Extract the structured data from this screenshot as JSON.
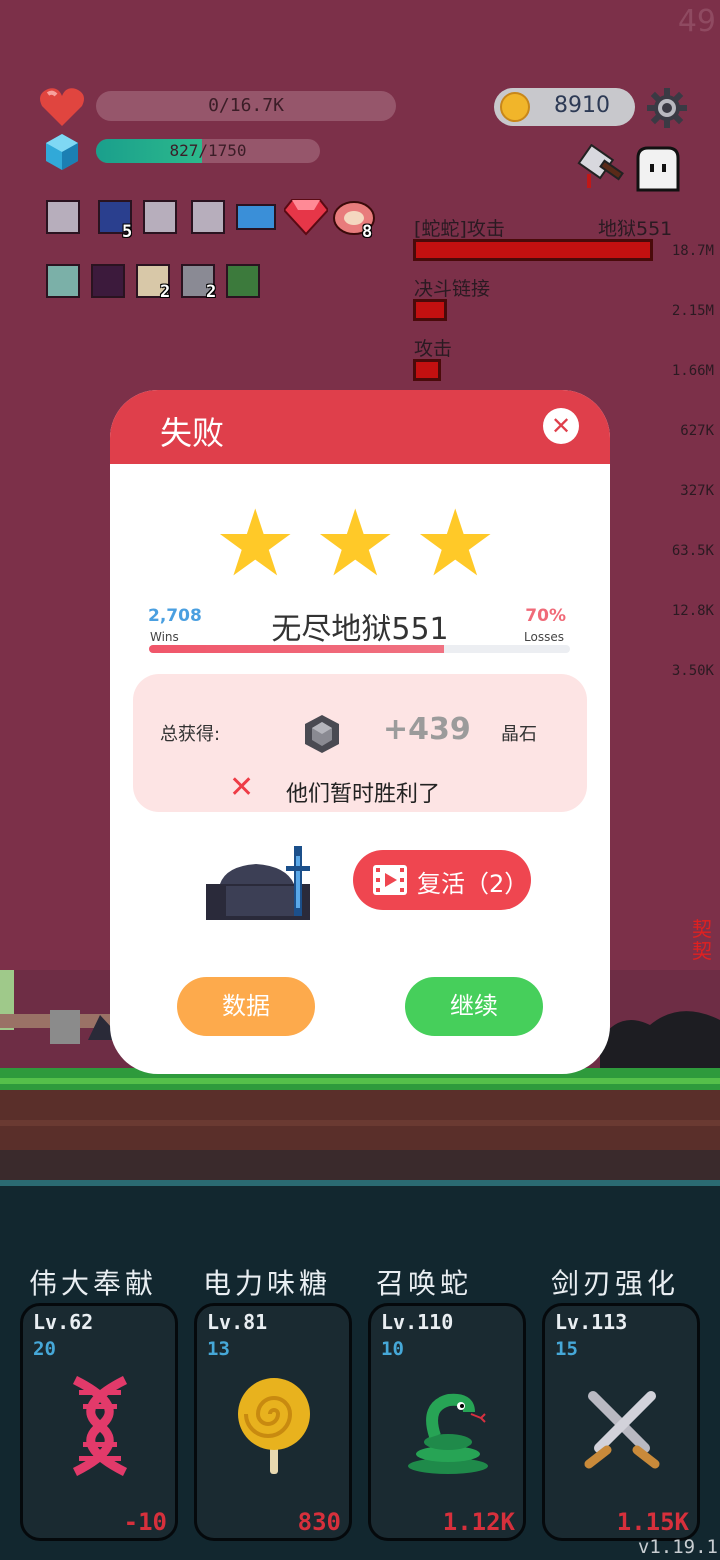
{
  "corner_number": "49",
  "hp": {
    "text": "0/16.7K",
    "fraction": 0.0
  },
  "xp": {
    "text_current": "827",
    "text_max": "/1750",
    "fraction": 0.473
  },
  "coins": {
    "value": "8910"
  },
  "inventory": {
    "row1": [
      {
        "icon": "scroll-ribbon-icon",
        "count": ""
      },
      {
        "icon": "holy-book-icon",
        "count": "5"
      },
      {
        "icon": "scroll-ribbon-icon",
        "count": ""
      },
      {
        "icon": "scroll-ribbon-icon",
        "count": ""
      },
      {
        "icon": "star-card-icon",
        "count": ""
      },
      {
        "icon": "ruby-gem-icon",
        "count": ""
      },
      {
        "icon": "meat-icon",
        "count": "8"
      }
    ],
    "row2": [
      {
        "icon": "lightbulb-tile-icon",
        "count": ""
      },
      {
        "icon": "demon-tile-icon",
        "count": ""
      },
      {
        "icon": "shell-tile-icon",
        "count": "2"
      },
      {
        "icon": "sword-tile-icon",
        "count": "2"
      },
      {
        "icon": "clover-tile-icon",
        "count": ""
      }
    ]
  },
  "combat_log": {
    "attacker": "[蛇蛇]攻击",
    "target": "地狱551",
    "rows": [
      {
        "label": "决斗链接"
      },
      {
        "label": "攻击"
      }
    ],
    "damage_values": [
      "18.7M",
      "2.15M",
      "1.66M",
      "627K",
      "327K",
      "63.5K",
      "12.8K",
      "3.50K"
    ],
    "edge_text": [
      "契",
      "契"
    ]
  },
  "modal": {
    "title": "失败",
    "stars": 3,
    "wins_value": "2,708",
    "wins_label": "Wins",
    "losses_value": "70%",
    "losses_label": "Losses",
    "stage_name": "无尽地狱551",
    "progress_fraction": 0.7,
    "reward_label": "总获得:",
    "reward_amount": "+439",
    "reward_unit": "晶石",
    "defeat_message": "他们暂时胜利了",
    "revive_label": "复活（2）",
    "data_label": "数据",
    "continue_label": "继续"
  },
  "skills": [
    {
      "name": "伟大奉献",
      "level": "Lv.62",
      "count": "20",
      "value": "-10",
      "icon": "dna-icon"
    },
    {
      "name": "电力味糖",
      "level": "Lv.81",
      "count": "13",
      "value": "830",
      "icon": "lollipop-icon"
    },
    {
      "name": "召唤蛇",
      "level": "Lv.110",
      "count": "10",
      "value": "1.12K",
      "icon": "snake-icon"
    },
    {
      "name": "剑刃强化",
      "level": "Lv.113",
      "count": "15",
      "value": "1.15K",
      "icon": "crossed-swords-icon"
    }
  ],
  "version": "v1.19.1",
  "colors": {
    "accent_red": "#df3f4b",
    "win_blue": "#4a9fe0",
    "loss_pink": "#f06a78",
    "star_yellow": "#ffc928",
    "continue_green": "#46cf5b",
    "data_orange": "#fdaa4c"
  }
}
